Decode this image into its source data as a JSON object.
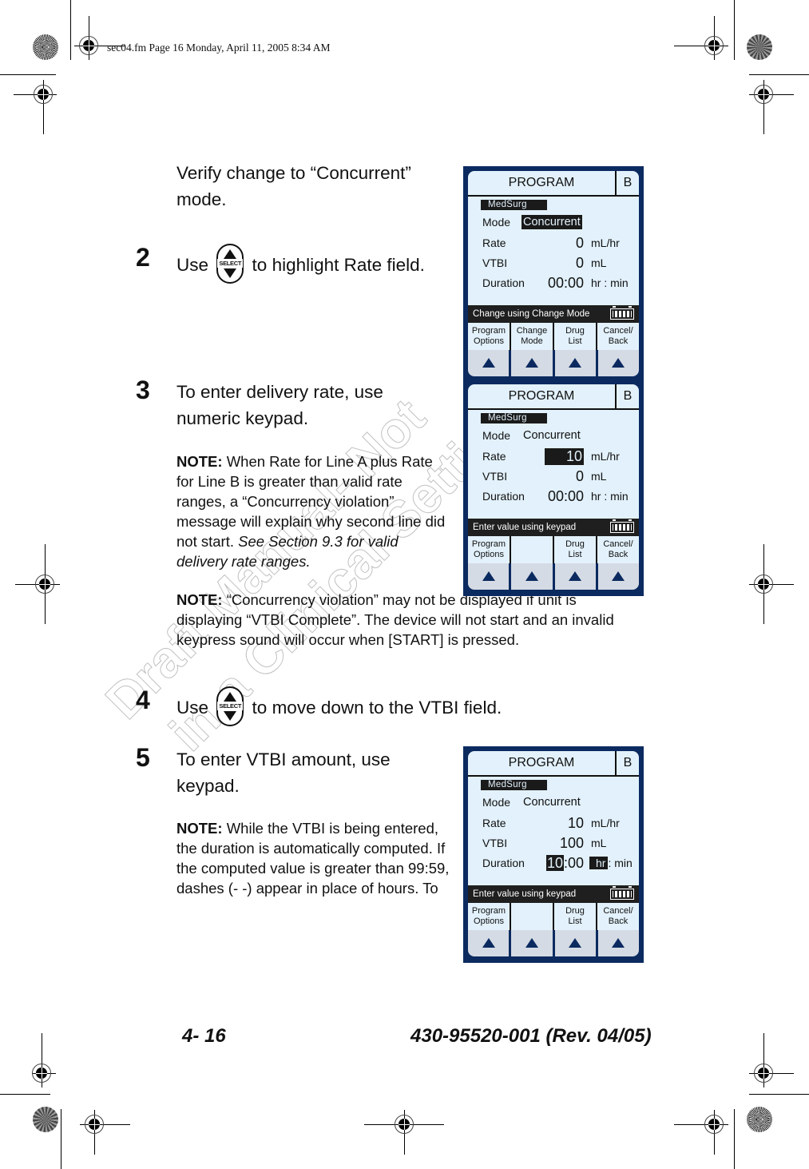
{
  "header_stamp": "sec04.fm  Page 16  Monday, April 11, 2005  8:34 AM",
  "watermark": {
    "line1": "Draft Manual- Not",
    "line2": "in a Clinical Setting Used"
  },
  "content": {
    "intro": "Verify change to “Concurrent” mode.",
    "steps": [
      {
        "number": "2",
        "text_before": "Use",
        "icon": "select-key-icon",
        "icon_label": "SELECT",
        "text_after": "to highlight Rate field."
      },
      {
        "number": "3",
        "text": "To enter delivery rate, use numeric keypad.",
        "note_label": "NOTE:",
        "note_text": "When Rate for Line A plus Rate for Line B is greater than valid rate ranges, a “Concurrency violation” message will explain why second line did not start.",
        "note_italic": "See Section 9.3 for valid delivery rate ranges."
      },
      {
        "number": "4",
        "text_before": "Use",
        "icon": "select-key-icon",
        "icon_label": "SELECT",
        "text_after": "to move down to the VTBI field."
      },
      {
        "number": "5",
        "text": "To enter VTBI amount, use keypad.",
        "note_label": "NOTE:",
        "note_text": "While the VTBI is being entered, the duration is automatically computed. If the computed value is greater than 99:59, dashes (- -) appear in place of hours. To"
      }
    ],
    "note2_label": "NOTE:",
    "note2_text": "“Concurrency violation” may not be displayed if unit is displaying “VTBI Complete”. The device will not start and an invalid keypress sound will occur when [START] is pressed."
  },
  "screens": [
    {
      "title": "PROGRAM",
      "line": "B",
      "profile": "MedSurg",
      "labels": {
        "mode": "Mode",
        "rate": "Rate",
        "vtbi": "VTBI",
        "duration": "Duration"
      },
      "mode": "Concurrent",
      "rate": "0",
      "vtbi": "0",
      "duration": "00:00",
      "units": {
        "rate": "mL/hr",
        "vtbi": "mL",
        "duration": "hr : min"
      },
      "message": "Change using Change Mode",
      "softkeys": [
        "Program\nOptions",
        "Change\nMode",
        "Drug\nList",
        "Cancel/\nBack"
      ]
    },
    {
      "title": "PROGRAM",
      "line": "B",
      "profile": "MedSurg",
      "labels": {
        "mode": "Mode",
        "rate": "Rate",
        "vtbi": "VTBI",
        "duration": "Duration"
      },
      "mode": "Concurrent",
      "rate": "10",
      "vtbi": "0",
      "duration": "00:00",
      "units": {
        "rate": "mL/hr",
        "vtbi": "mL",
        "duration": "hr : min"
      },
      "message": "Enter value using keypad",
      "softkeys": [
        "Program\nOptions",
        "",
        "Drug\nList",
        "Cancel/\nBack"
      ]
    },
    {
      "title": "PROGRAM",
      "line": "B",
      "profile": "MedSurg",
      "labels": {
        "mode": "Mode",
        "rate": "Rate",
        "vtbi": "VTBI",
        "duration": "Duration"
      },
      "mode": "Concurrent",
      "rate": "10",
      "vtbi": "100",
      "duration_hours": "10",
      "duration_rest": ":00",
      "units": {
        "rate": "mL/hr",
        "vtbi": "mL",
        "duration_hr": "hr",
        "duration_rest": ": min"
      },
      "message": "Enter value using keypad",
      "softkeys": [
        "Program\nOptions",
        "",
        "Drug\nList",
        "Cancel/\nBack"
      ]
    }
  ],
  "footer": {
    "page_number": "4- 16",
    "doc_number": "430-95520-001 (Rev. 04/05)"
  }
}
